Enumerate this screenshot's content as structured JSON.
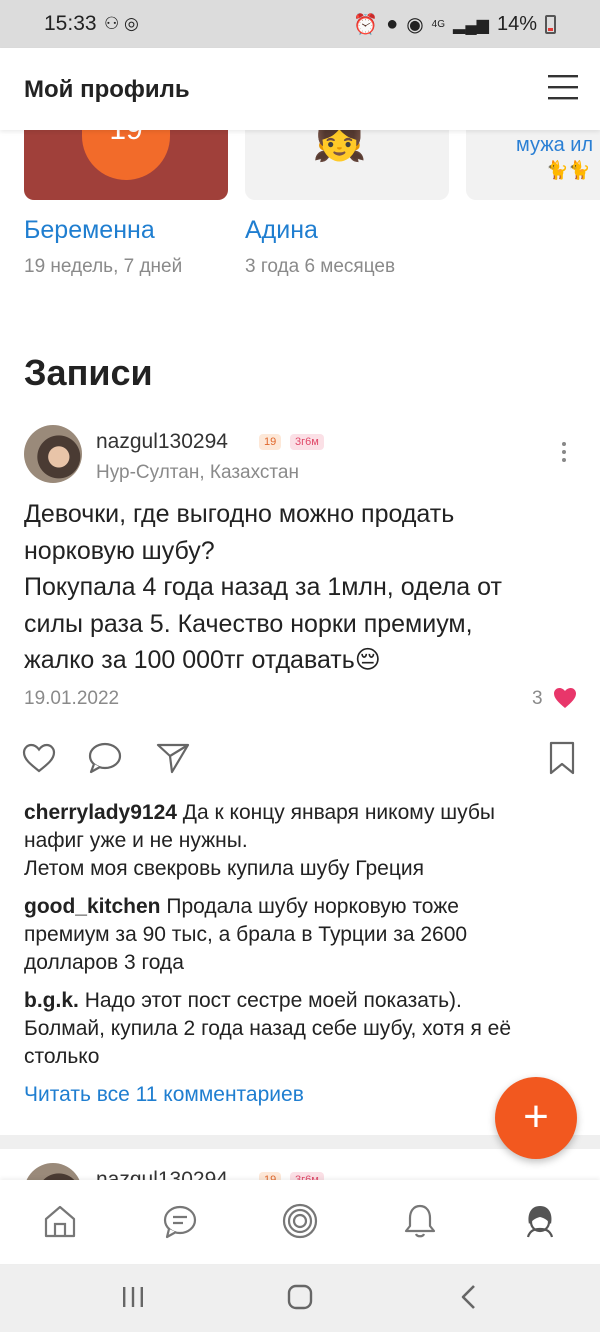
{
  "status_bar": {
    "time": "15:33",
    "network": "4G",
    "battery": "14%"
  },
  "header": {
    "title": "Мой профиль"
  },
  "children": [
    {
      "badge": "19",
      "name": "Беременна",
      "sub": "19 недель, 7 дней"
    },
    {
      "emoji": "👧",
      "name": "Адина",
      "sub": "3 года 6 месяцев"
    },
    {
      "text": "мужа ил",
      "emoji": "🐈🐈"
    }
  ],
  "section_title": "Записи",
  "post": {
    "username": "nazgul130294",
    "tag1": "19",
    "tag2": "3г6м",
    "location": "Нур-Султан, Казахстан",
    "text_lines": [
      "Девочки, где выгодно можно продать",
      "норковую шубу?",
      "Покупала 4 года назад за 1млн, одела от",
      "силы раза 5. Качество норки премиум,",
      "жалко за 100 000тг отдавать😔"
    ],
    "date": "19.01.2022",
    "likes": "3"
  },
  "comments": [
    {
      "author": "cherrylady9124",
      "lines": [
        "Да к концу января никому шубы",
        "нафиг уже и не нужны.",
        "Летом моя свекровь купила шубу Греция"
      ]
    },
    {
      "author": "good_kitchen",
      "lines": [
        "Продала шубу норковую тоже",
        "премиум за 90 тыс, а брала в Турции за 2600",
        "долларов 3 года"
      ]
    },
    {
      "author": "b.g.k.",
      "lines": [
        "Надо этот пост сестре моей показать).",
        "Болмай, купила 2 года назад себе шубу, хотя я её",
        "столько"
      ]
    }
  ],
  "read_all": "Читать все 11 комментариев",
  "fab": "+",
  "next_post": {
    "username": "nazgul130294",
    "tag1": "19",
    "tag2": "3г6м"
  },
  "bottom_nav": [
    "home-icon",
    "chat-icon",
    "target-icon",
    "bell-icon",
    "profile-icon"
  ],
  "colors": {
    "accent": "#f2581f",
    "link": "#1f7ed0",
    "heart": "#e8366a"
  }
}
